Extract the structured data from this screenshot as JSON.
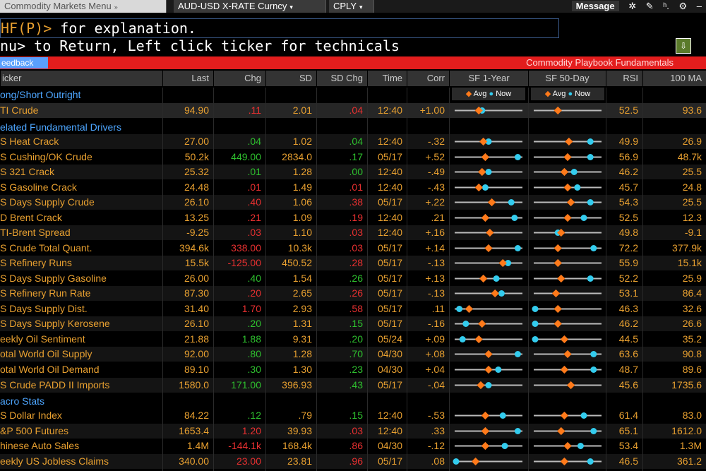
{
  "tabs": [
    {
      "label": "Commodity Markets Menu",
      "arrow": "»",
      "active": true
    },
    {
      "label": "AUD-USD X-RATE Curncy",
      "arrow": "▾",
      "active": false
    },
    {
      "label": "CPLY",
      "arrow": "▾",
      "active": false
    }
  ],
  "toolbar": {
    "message": "Message",
    "icons": [
      "settings-icon",
      "pencil-icon",
      "help-icon",
      "gear-icon",
      "minimize-icon"
    ]
  },
  "command": {
    "hf": "HF(P)>",
    "rest": " for explanation.",
    "line2": "nu> to Return, Left click ticker for technicals"
  },
  "banner": {
    "feed": "eedback",
    "title": "Commodity Playbook Fundamentals"
  },
  "headers": {
    "ticker": "icker",
    "last": "Last",
    "chg": "Chg",
    "sd": "SD",
    "sdchg": "SD Chg",
    "time": "Time",
    "corr": "Corr",
    "sf1": "SF 1-Year",
    "sf2": "SF 50-Day",
    "rsi": "RSI",
    "ma": "100 MA"
  },
  "legend": {
    "avg": "Avg",
    "now": "Now"
  },
  "sections": {
    "s1": "ong/Short Outright",
    "s2": "elated Fundamental Drivers",
    "s3": "acro Stats"
  },
  "colors": {
    "avg": "#ff7a1a",
    "now": "#33ccee",
    "pos": "#2ec02e",
    "neg": "#e83030"
  },
  "rows": [
    {
      "t": "TI Crude",
      "last": "94.90",
      "chg": ".11",
      "cs": "neg",
      "sd": "2.01",
      "sdc": ".04",
      "ss": "neg",
      "time": "12:40",
      "corr": "+1.00",
      "rsi": "52.5",
      "ma": "93.6",
      "s1": [
        0.35,
        0.4
      ],
      "s2": [
        0.35,
        null
      ]
    },
    {
      "t": "S Heat Crack",
      "last": "27.00",
      "chg": ".04",
      "cs": "pos",
      "sd": "1.02",
      "sdc": ".04",
      "ss": "pos",
      "time": "12:40",
      "corr": "-.32",
      "rsi": "49.9",
      "ma": "26.9",
      "s1": [
        0.42,
        0.5
      ],
      "s2": [
        0.52,
        0.85
      ]
    },
    {
      "t": "S Cushing/OK Crude",
      "last": "50.2k",
      "chg": "449.00",
      "cs": "pos",
      "sd": "2834.0",
      "sdc": ".17",
      "ss": "pos",
      "time": "05/17",
      "corr": "+.52",
      "rsi": "56.9",
      "ma": "48.7k",
      "s1": [
        0.45,
        0.95
      ],
      "s2": [
        0.5,
        0.85
      ]
    },
    {
      "t": "S 321 Crack",
      "last": "25.32",
      "chg": ".01",
      "cs": "pos",
      "sd": "1.28",
      "sdc": ".00",
      "ss": "pos",
      "time": "12:40",
      "corr": "-.49",
      "rsi": "46.2",
      "ma": "25.5",
      "s1": [
        0.4,
        0.5
      ],
      "s2": [
        0.45,
        0.6
      ]
    },
    {
      "t": "S Gasoline Crack",
      "last": "24.48",
      "chg": ".01",
      "cs": "neg",
      "sd": "1.49",
      "sdc": ".01",
      "ss": "neg",
      "time": "12:40",
      "corr": "-.43",
      "rsi": "45.7",
      "ma": "24.8",
      "s1": [
        0.35,
        0.45
      ],
      "s2": [
        0.5,
        0.65
      ]
    },
    {
      "t": "S Days Supply Crude",
      "last": "26.10",
      "chg": ".40",
      "cs": "neg",
      "sd": "1.06",
      "sdc": ".38",
      "ss": "neg",
      "time": "05/17",
      "corr": "+.22",
      "rsi": "54.3",
      "ma": "25.5",
      "s1": [
        0.55,
        0.85
      ],
      "s2": [
        0.55,
        0.85
      ]
    },
    {
      "t": "D Brent Crack",
      "last": "13.25",
      "chg": ".21",
      "cs": "neg",
      "sd": "1.09",
      "sdc": ".19",
      "ss": "neg",
      "time": "12:40",
      "corr": ".21",
      "rsi": "52.5",
      "ma": "12.3",
      "s1": [
        0.45,
        0.9
      ],
      "s2": [
        0.5,
        0.75
      ]
    },
    {
      "t": "TI-Brent Spread",
      "last": "-9.25",
      "chg": ".03",
      "cs": "neg",
      "sd": "1.10",
      "sdc": ".03",
      "ss": "neg",
      "time": "12:40",
      "corr": "+.16",
      "rsi": "49.8",
      "ma": "-9.1",
      "s1": [
        0.52,
        null
      ],
      "s2": [
        0.4,
        0.35
      ]
    },
    {
      "t": "S Crude Total Quant.",
      "last": "394.6k",
      "chg": "338.00",
      "cs": "neg",
      "sd": "10.3k",
      "sdc": ".03",
      "ss": "neg",
      "time": "05/17",
      "corr": "+.14",
      "rsi": "72.2",
      "ma": "377.9k",
      "s1": [
        0.5,
        0.95
      ],
      "s2": [
        0.35,
        0.9
      ]
    },
    {
      "t": "S Refinery Runs",
      "last": "15.5k",
      "chg": "-125.00",
      "cs": "neg",
      "sd": "450.52",
      "sdc": ".28",
      "ss": "neg",
      "time": "05/17",
      "corr": "-.13",
      "rsi": "55.9",
      "ma": "15.1k",
      "s1": [
        0.72,
        0.8
      ],
      "s2": [
        0.35,
        null
      ]
    },
    {
      "t": "S Days Supply Gasoline",
      "last": "26.00",
      "chg": ".40",
      "cs": "pos",
      "sd": "1.54",
      "sdc": ".26",
      "ss": "pos",
      "time": "05/17",
      "corr": "+.13",
      "rsi": "52.2",
      "ma": "25.9",
      "s1": [
        0.42,
        0.62
      ],
      "s2": [
        0.4,
        0.85
      ]
    },
    {
      "t": "S Refinery Run Rate",
      "last": "87.30",
      "chg": ".20",
      "cs": "neg",
      "sd": "2.65",
      "sdc": ".26",
      "ss": "neg",
      "time": "05/17",
      "corr": "-.13",
      "rsi": "53.1",
      "ma": "86.4",
      "s1": [
        0.6,
        0.7
      ],
      "s2": [
        0.32,
        null
      ]
    },
    {
      "t": "S Days Supply Dist.",
      "last": "31.40",
      "chg": "1.70",
      "cs": "neg",
      "sd": "2.93",
      "sdc": ".58",
      "ss": "neg",
      "time": "05/17",
      "corr": ".11",
      "rsi": "46.3",
      "ma": "32.6",
      "s1": [
        0.2,
        0.05
      ],
      "s2": [
        0.35,
        0.0
      ]
    },
    {
      "t": "S Days Supply Kerosene",
      "last": "26.10",
      "chg": ".20",
      "cs": "pos",
      "sd": "1.31",
      "sdc": ".15",
      "ss": "pos",
      "time": "05/17",
      "corr": "-.16",
      "rsi": "46.2",
      "ma": "26.6",
      "s1": [
        0.4,
        0.15
      ],
      "s2": [
        0.35,
        0.0
      ]
    },
    {
      "t": "eekly Oil Sentiment",
      "last": "21.88",
      "chg": "1.88",
      "cs": "pos",
      "sd": "9.31",
      "sdc": ".20",
      "ss": "pos",
      "time": "05/24",
      "corr": "+.09",
      "rsi": "44.5",
      "ma": "35.2",
      "s1": [
        0.35,
        0.1
      ],
      "s2": [
        0.45,
        0.0
      ]
    },
    {
      "t": "otal World Oil Supply",
      "last": "92.00",
      "chg": ".80",
      "cs": "pos",
      "sd": "1.28",
      "sdc": ".70",
      "ss": "pos",
      "time": "04/30",
      "corr": "+.08",
      "rsi": "63.6",
      "ma": "90.8",
      "s1": [
        0.5,
        0.95
      ],
      "s2": [
        0.5,
        0.9
      ]
    },
    {
      "t": "otal World Oil Demand",
      "last": "89.10",
      "chg": ".30",
      "cs": "pos",
      "sd": "1.30",
      "sdc": ".23",
      "ss": "pos",
      "time": "04/30",
      "corr": "+.04",
      "rsi": "48.7",
      "ma": "89.6",
      "s1": [
        0.5,
        0.65
      ],
      "s2": [
        0.45,
        0.9
      ]
    },
    {
      "t": "S Crude PADD II Imports",
      "last": "1580.0",
      "chg": "171.00",
      "cs": "pos",
      "sd": "396.93",
      "sdc": ".43",
      "ss": "pos",
      "time": "05/17",
      "corr": "-.04",
      "rsi": "45.6",
      "ma": "1735.6",
      "s1": [
        0.38,
        0.5
      ],
      "s2": [
        0.55,
        null
      ]
    },
    {
      "t": "S Dollar Index",
      "last": "84.22",
      "chg": ".12",
      "cs": "pos",
      "sd": ".79",
      "sdc": ".15",
      "ss": "pos",
      "time": "12:40",
      "corr": "-.53",
      "rsi": "61.4",
      "ma": "83.0",
      "s1": [
        0.45,
        0.72
      ],
      "s2": [
        0.45,
        0.75
      ]
    },
    {
      "t": "&P 500 Futures",
      "last": "1653.4",
      "chg": "1.20",
      "cs": "neg",
      "sd": "39.93",
      "sdc": ".03",
      "ss": "neg",
      "time": "12:40",
      "corr": ".33",
      "rsi": "65.1",
      "ma": "1612.0",
      "s1": [
        0.45,
        0.95
      ],
      "s2": [
        0.4,
        0.9
      ]
    },
    {
      "t": "hinese Auto Sales",
      "last": "1.4M",
      "chg": "-144.1k",
      "cs": "neg",
      "sd": "168.4k",
      "sdc": ".86",
      "ss": "neg",
      "time": "04/30",
      "corr": "-.12",
      "rsi": "53.4",
      "ma": "1.3M",
      "s1": [
        0.45,
        0.75
      ],
      "s2": [
        0.5,
        0.7
      ]
    },
    {
      "t": "eekly US Jobless Claims",
      "last": "340.00",
      "chg": "23.00",
      "cs": "neg",
      "sd": "23.81",
      "sdc": ".96",
      "ss": "neg",
      "time": "05/17",
      "corr": ".08",
      "rsi": "46.5",
      "ma": "361.2",
      "s1": [
        0.3,
        0.0
      ],
      "s2": [
        0.45,
        0.85
      ]
    }
  ]
}
